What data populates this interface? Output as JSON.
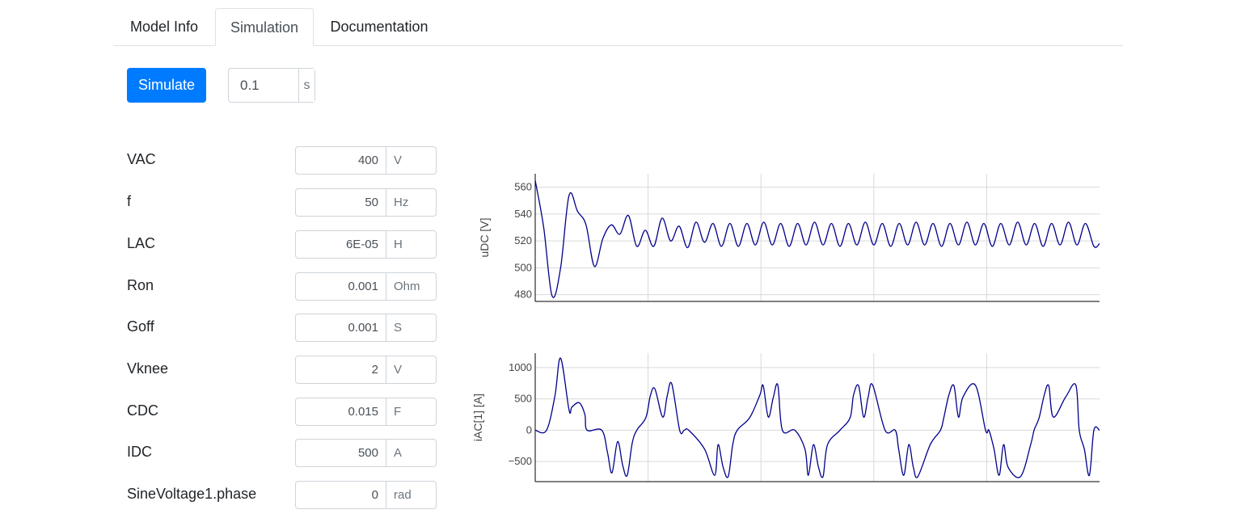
{
  "tabs": [
    {
      "label": "Model Info",
      "active": false
    },
    {
      "label": "Simulation",
      "active": true
    },
    {
      "label": "Documentation",
      "active": false
    }
  ],
  "toolbar": {
    "simulate_label": "Simulate",
    "stop_time_value": "0.1",
    "stop_time_unit": "s"
  },
  "params": [
    {
      "name": "VAC",
      "value": "400",
      "unit": "V"
    },
    {
      "name": "f",
      "value": "50",
      "unit": "Hz"
    },
    {
      "name": "LAC",
      "value": "6E-05",
      "unit": "H"
    },
    {
      "name": "Ron",
      "value": "0.001",
      "unit": "Ohm"
    },
    {
      "name": "Goff",
      "value": "0.001",
      "unit": "S"
    },
    {
      "name": "Vknee",
      "value": "2",
      "unit": "V"
    },
    {
      "name": "CDC",
      "value": "0.015",
      "unit": "F"
    },
    {
      "name": "IDC",
      "value": "500",
      "unit": "A"
    },
    {
      "name": "SineVoltage1.phase",
      "value": "0",
      "unit": "rad"
    }
  ],
  "colors": {
    "accent": "#007bff",
    "trace": "#00008b",
    "grid": "#d9d9d9"
  },
  "chart_data": [
    {
      "type": "line",
      "title": "",
      "xlabel": "",
      "ylabel": "uDC [V]",
      "xlim": [
        0,
        0.1
      ],
      "ylim": [
        475,
        570
      ],
      "yticks": [
        480,
        500,
        520,
        540,
        560
      ],
      "series": [
        {
          "x": [
            0,
            0.0015,
            0.003,
            0.0045,
            0.006,
            0.0075,
            0.009,
            0.0105,
            0.012,
            0.0135,
            0.015,
            0.0165,
            0.018,
            0.0195,
            0.021,
            0.0225,
            0.024,
            0.0255,
            0.027,
            0.0285,
            0.03,
            0.0315,
            0.033,
            0.0345,
            0.036,
            0.0375,
            0.039,
            0.0405,
            0.042,
            0.0435,
            0.045,
            0.0465,
            0.048,
            0.0495,
            0.051,
            0.0525,
            0.054,
            0.0555,
            0.057,
            0.0585,
            0.06,
            0.0615,
            0.063,
            0.0645,
            0.066,
            0.0675,
            0.069,
            0.0705,
            0.072,
            0.0735,
            0.075,
            0.0765,
            0.078,
            0.0795,
            0.081,
            0.0825,
            0.084,
            0.0855,
            0.087,
            0.0885,
            0.09,
            0.0915,
            0.093,
            0.0945,
            0.096,
            0.0975,
            0.099,
            0.1
          ],
          "y": [
            565,
            530,
            479,
            500,
            554,
            542,
            532,
            501,
            522,
            532,
            525,
            539,
            516,
            528,
            516,
            537,
            520,
            531,
            515,
            534,
            519,
            533,
            516,
            533,
            516,
            533,
            517,
            534,
            517,
            533,
            516,
            533,
            517,
            534,
            517,
            533,
            516,
            533,
            517,
            534,
            517,
            533,
            516,
            533,
            517,
            534,
            517,
            533,
            516,
            533,
            517,
            534,
            517,
            533,
            516,
            533,
            517,
            534,
            517,
            533,
            516,
            533,
            517,
            534,
            517,
            533,
            516,
            518
          ]
        }
      ]
    },
    {
      "type": "line",
      "title": "",
      "xlabel": "",
      "ylabel": "iAC[1] [A]",
      "xlim": [
        0,
        0.1
      ],
      "ylim": [
        -820,
        1230
      ],
      "yticks": [
        -500,
        0,
        500,
        1000
      ],
      "series": [
        {
          "x": [
            0,
            0.002,
            0.0035,
            0.0045,
            0.006,
            0.0065,
            0.0078,
            0.0088,
            0.0092,
            0.0118,
            0.0128,
            0.0136,
            0.0146,
            0.0155,
            0.0163,
            0.0172,
            0.018,
            0.0196,
            0.0204,
            0.0212,
            0.0226,
            0.0234,
            0.0242,
            0.0256,
            0.0264,
            0.0272,
            0.03,
            0.0318,
            0.0324,
            0.0333,
            0.0342,
            0.035,
            0.0358,
            0.038,
            0.0398,
            0.0404,
            0.0413,
            0.0422,
            0.043,
            0.0438,
            0.046,
            0.0478,
            0.0484,
            0.0493,
            0.0502,
            0.051,
            0.0518,
            0.054,
            0.0558,
            0.0564,
            0.0573,
            0.0582,
            0.059,
            0.0598,
            0.062,
            0.0638,
            0.0644,
            0.0653,
            0.0662,
            0.067,
            0.0678,
            0.07,
            0.0718,
            0.0724,
            0.0733,
            0.0742,
            0.075,
            0.0758,
            0.078,
            0.0798,
            0.0804,
            0.0813,
            0.0822,
            0.083,
            0.0838,
            0.086,
            0.0878,
            0.0884,
            0.0893,
            0.0902,
            0.091,
            0.0918,
            0.094,
            0.0958,
            0.0964,
            0.0973,
            0.0982,
            0.099,
            0.1
          ],
          "y": [
            0,
            0,
            550,
            1150,
            320,
            370,
            440,
            250,
            0,
            0,
            -350,
            -680,
            -180,
            -560,
            -720,
            -200,
            0,
            200,
            550,
            660,
            210,
            550,
            740,
            0,
            0,
            0,
            -300,
            -720,
            -230,
            -590,
            -740,
            -230,
            0,
            200,
            560,
            710,
            210,
            530,
            720,
            0,
            0,
            -300,
            -720,
            -230,
            -590,
            -740,
            -230,
            0,
            200,
            560,
            710,
            210,
            530,
            720,
            0,
            0,
            -300,
            -720,
            -230,
            -590,
            -740,
            -230,
            0,
            200,
            560,
            710,
            210,
            530,
            720,
            0,
            0,
            -300,
            -720,
            -230,
            -590,
            -740,
            -230,
            0,
            200,
            560,
            710,
            210,
            530,
            720,
            0,
            -300,
            -720,
            0,
            0
          ]
        }
      ]
    }
  ]
}
